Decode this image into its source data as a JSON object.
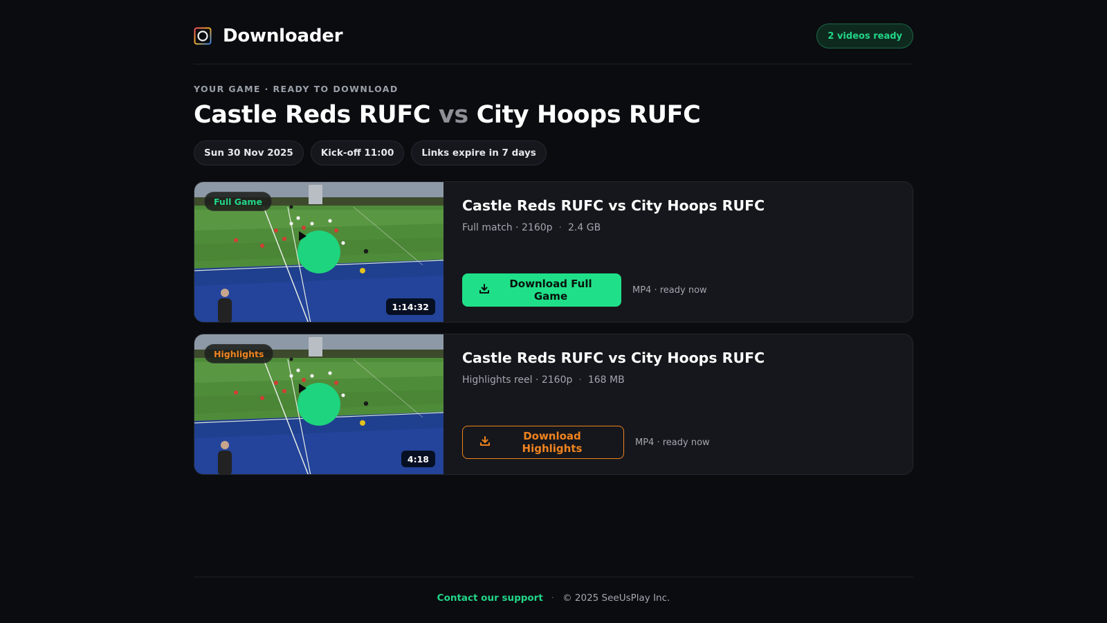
{
  "header": {
    "brand_name": "Downloader",
    "logo_icon": "ring-logo-icon",
    "ready_badge": "2 videos ready"
  },
  "hero": {
    "eyebrow": "YOUR GAME · READY TO DOWNLOAD",
    "home_team": "Castle Reds RUFC",
    "vs": "vs",
    "away_team": "City Hoops RUFC",
    "chips": [
      "Sun 30 Nov 2025",
      "Kick-off 11:00",
      "Links expire in 7 days"
    ]
  },
  "videos": [
    {
      "tag": "Full Game",
      "duration": "1:14:32",
      "title": "Castle Reds RUFC vs City Hoops RUFC",
      "meta_desc": "Full match · 2160p",
      "size": "2.4 GB",
      "button_label": "Download Full Game",
      "format_note": "MP4 · ready now",
      "accent": "#1fe088"
    },
    {
      "tag": "Highlights",
      "duration": "4:18",
      "title": "Castle Reds RUFC vs City Hoops RUFC",
      "meta_desc": "Highlights reel · 2160p",
      "size": "168 MB",
      "button_label": "Download Highlights",
      "format_note": "MP4 · ready now",
      "accent": "#f0831e"
    }
  ],
  "footer": {
    "support_link": "Contact our support",
    "separator": "·",
    "copyright": "© 2025 SeeUsPlay Inc."
  },
  "colors": {
    "background": "#0b0c10",
    "card": "#16171c",
    "green_accent": "#1fe088",
    "orange_accent": "#f0831e"
  }
}
